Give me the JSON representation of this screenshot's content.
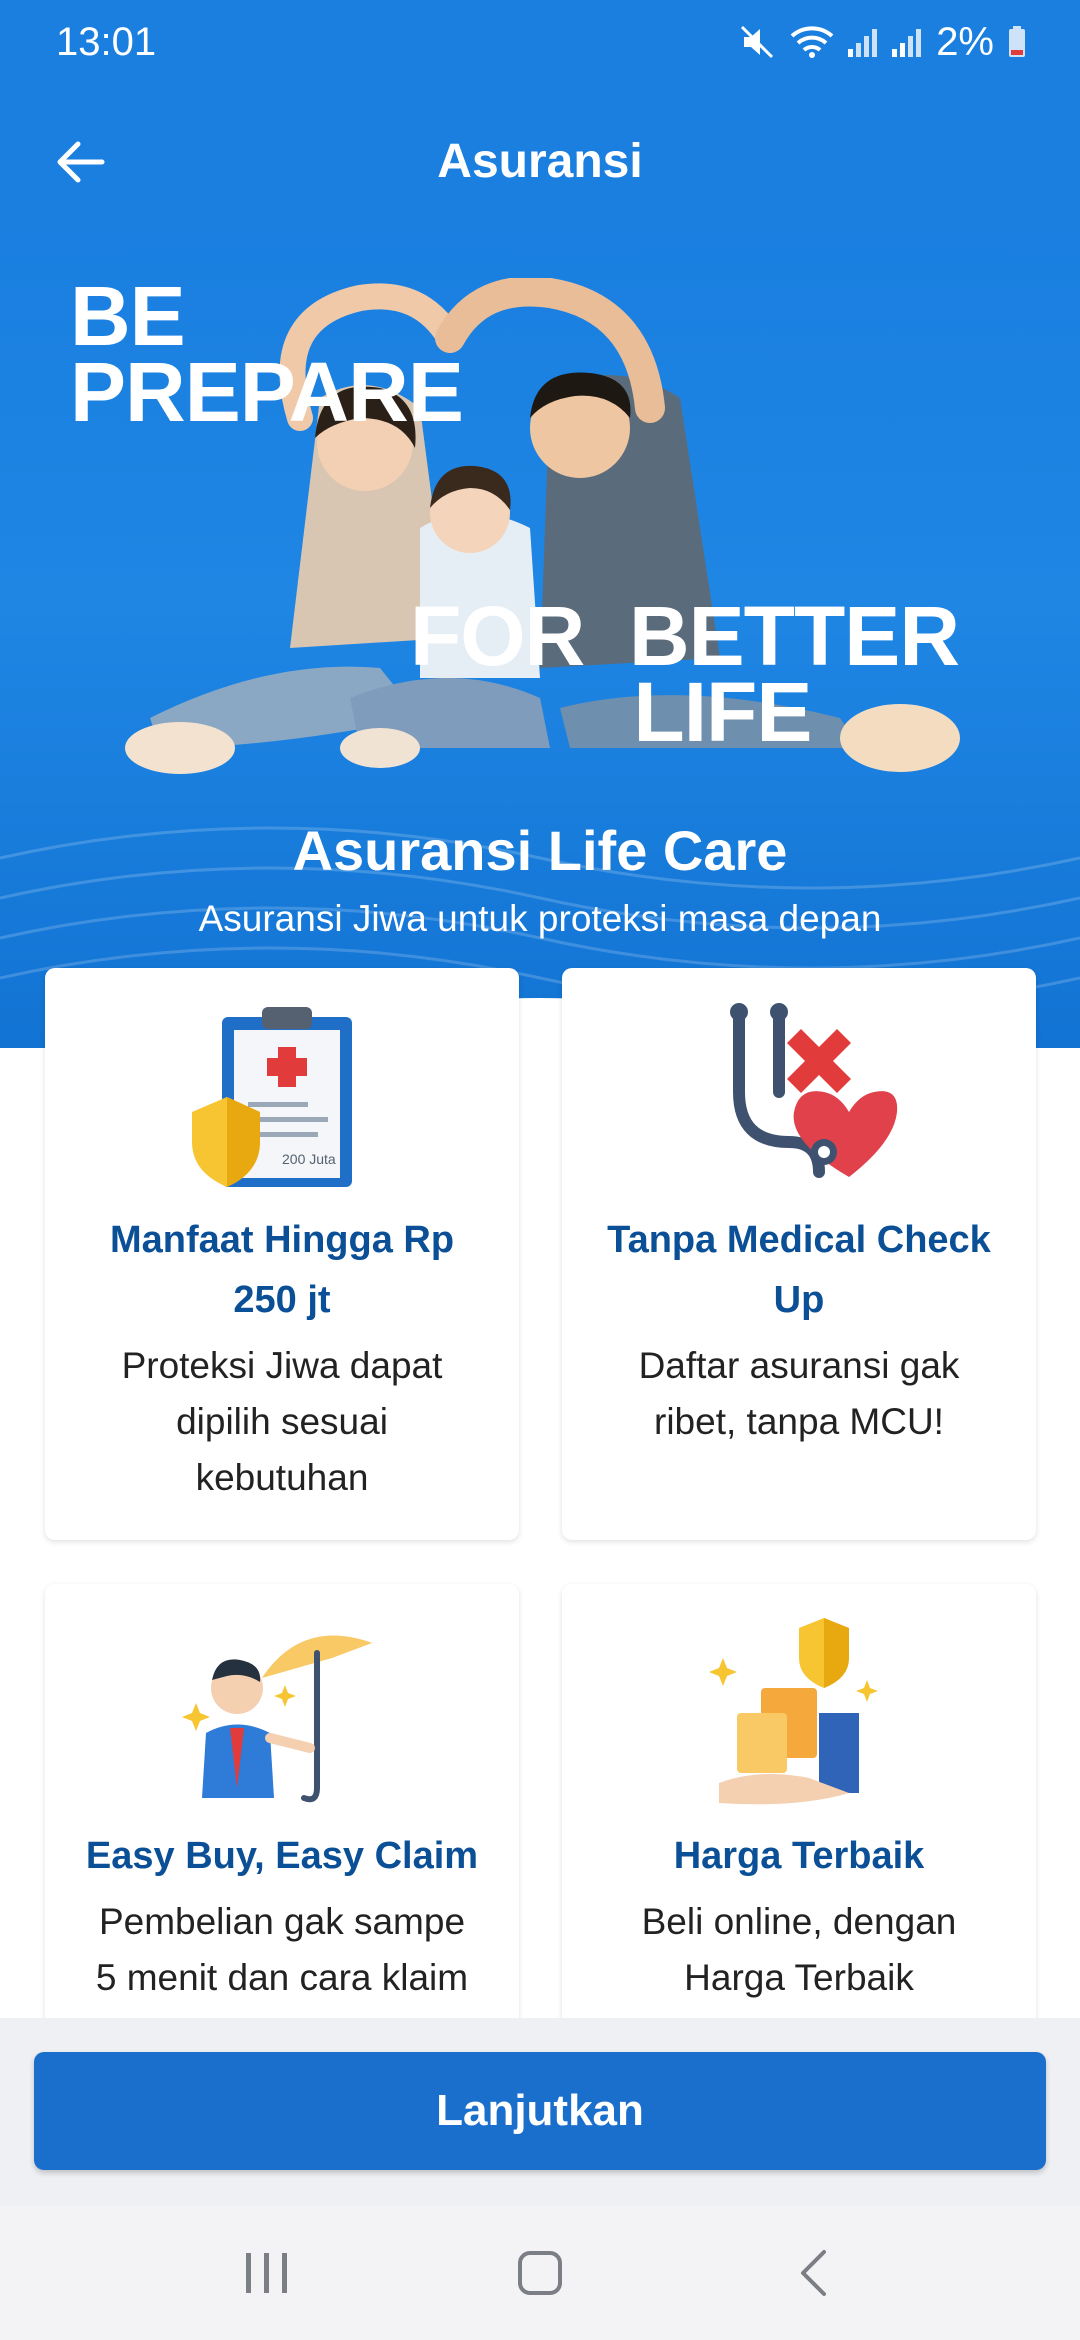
{
  "status": {
    "time": "13:01",
    "battery": "2%"
  },
  "header": {
    "title": "Asuransi"
  },
  "hero": {
    "tagline_1": "BE\nPREPARE",
    "tagline_2": "FOR  BETTER\n          LIFE",
    "title": "Asuransi Life Care",
    "subtitle": "Asuransi Jiwa untuk proteksi masa depan"
  },
  "cards": [
    {
      "title": "Manfaat Hingga Rp 250 jt",
      "desc": "Proteksi Jiwa dapat dipilih sesuai kebutuhan",
      "icon": "clipboard-shield-icon",
      "icon_text": "200 Juta"
    },
    {
      "title": "Tanpa Medical Check Up",
      "desc": "Daftar asuransi gak ribet, tanpa MCU!",
      "icon": "stethoscope-heart-icon"
    },
    {
      "title": "Easy Buy, Easy Claim",
      "desc": "Pembelian gak sampe 5 menit dan cara klaim",
      "icon": "umbrella-person-icon"
    },
    {
      "title": "Harga Terbaik",
      "desc": "Beli online, dengan Harga Terbaik",
      "icon": "coins-shield-icon"
    }
  ],
  "cta": {
    "label": "Lanjutkan"
  },
  "colors": {
    "primary": "#1b7fe0",
    "button": "#1a6fcc",
    "card_title": "#0b4f96"
  }
}
